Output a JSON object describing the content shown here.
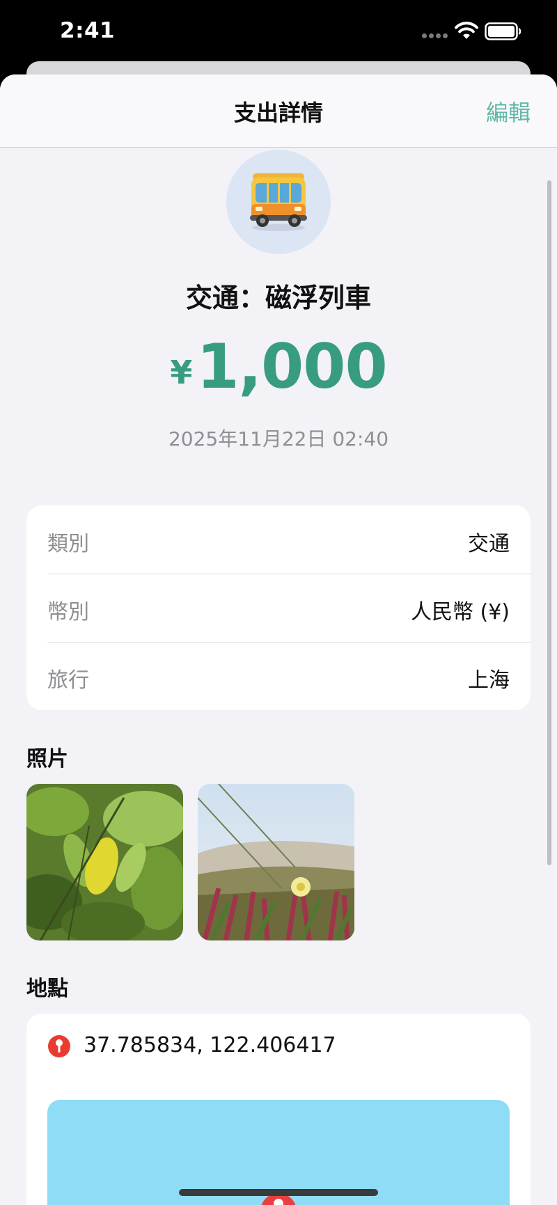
{
  "status_bar": {
    "time": "2:41"
  },
  "nav": {
    "title": "支出詳情",
    "edit_label": "編輯"
  },
  "expense": {
    "category_icon": "bus-icon",
    "title": "交通：磁浮列車",
    "currency_symbol": "¥",
    "amount": "1,000",
    "date": "2025年11月22日 02:40"
  },
  "details": [
    {
      "label": "類別",
      "value": "交通"
    },
    {
      "label": "幣別",
      "value": "人民幣 (¥)"
    },
    {
      "label": "旅行",
      "value": "上海"
    }
  ],
  "photos": {
    "header": "照片"
  },
  "location": {
    "header": "地點",
    "coordinates": "37.785834, 122.406417"
  },
  "colors": {
    "accent": "#389c80",
    "edit": "#62b8a8",
    "background": "#f2f2f7",
    "map": "#8edcf5",
    "pin": "#e84040"
  }
}
